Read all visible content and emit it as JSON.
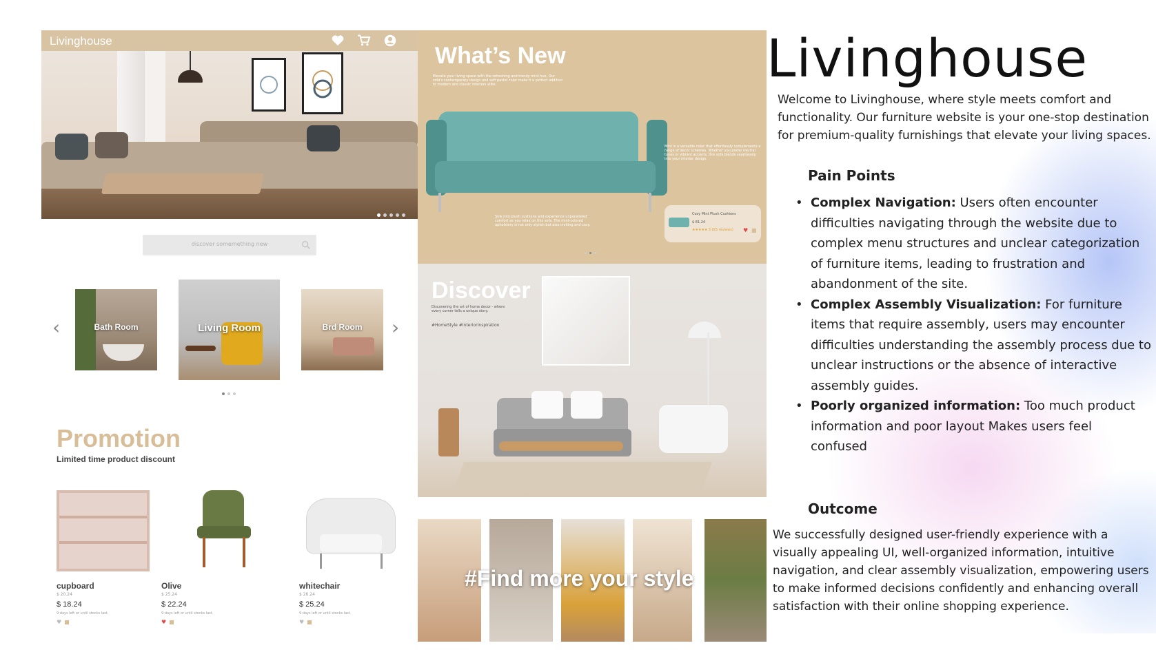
{
  "app": {
    "brand": "Livinghouse"
  },
  "left_screen": {
    "search_placeholder": "discover somemething new",
    "categories": [
      {
        "label": "Bath Room"
      },
      {
        "label": "Living Room"
      },
      {
        "label": "Brd Room"
      }
    ],
    "promotion": {
      "title": "Promotion",
      "subtitle": "Limited time product discount"
    },
    "products": [
      {
        "name": "cupboard",
        "old_price": "$ 20.24",
        "price": "$ 18.24",
        "stock": "9 days left or until stocks last."
      },
      {
        "name": "Olive",
        "old_price": "$ 25.24",
        "price": "$ 22.24",
        "stock": "9 days left or until stocks last."
      },
      {
        "name": "whitechair",
        "old_price": "$ 26.24",
        "price": "$ 25.24",
        "stock": "9 days left or until stocks last."
      }
    ]
  },
  "whats_new": {
    "title": "What’s New",
    "intro": "Elevate your living space with the refreshing and trendy mint hue. Our sofa's contemporary design and soft pastel color make it a perfect addition to modern and classic interiors alike.",
    "side_text": "Mint is a versatile color that effortlessly complements a range of decor schemes. Whether you prefer neutral tones or vibrant accents, this sofa blends seamlessly into your interior design.",
    "bottom_text": "Sink into plush cushions and experience unparalleled comfort as you relax on this sofa. The mint-colored upholstery is not only stylish but also inviting and cozy.",
    "card": {
      "name": "Cozy Mint Plush Cushions",
      "price": "$ 81.24",
      "rating": "★★★★★ 5.0(5 reviews)"
    }
  },
  "discover": {
    "title": "Discover",
    "text": "Discovering the art of home decor - where every corner tells a unique story.",
    "tags": "#HomeStyle  #InteriorInspiration"
  },
  "strip": {
    "text": "#Find more your style"
  },
  "case_study": {
    "title": "Livinghouse",
    "intro": "Welcome to Livinghouse, where style meets comfort and functionality. Our furniture website is your one-stop destination for premium-quality furnishings that elevate your living spaces.",
    "pain_points_heading": "Pain Points",
    "pain_points": [
      {
        "title": "Complex Navigation:",
        "text": " Users often encounter difficulties navigating through the website due to complex menu structures and unclear categorization of furniture items, leading to frustration and abandonment of the site."
      },
      {
        "title": "Complex Assembly Visualization:",
        "text": " For furniture items that require assembly, users may encounter difficulties understanding the assembly process due to unclear instructions or the absence of interactive assembly guides."
      },
      {
        "title": "Poorly organized information:",
        "text": " Too much product information and poor layout Makes users feel confused"
      }
    ],
    "outcome_heading": "Outcome",
    "outcome": "We successfully designed user-friendly experience with a visually appealing UI, well-organized information, intuitive navigation, and clear assembly visualization, empowering users to make informed decisions confidently and enhancing overall satisfaction with their online shopping experience."
  },
  "colors": {
    "beige": "#dcc49f",
    "topbar": "#d8c3a3",
    "promo": "#d8be98",
    "mint": "#6fb1ac"
  }
}
